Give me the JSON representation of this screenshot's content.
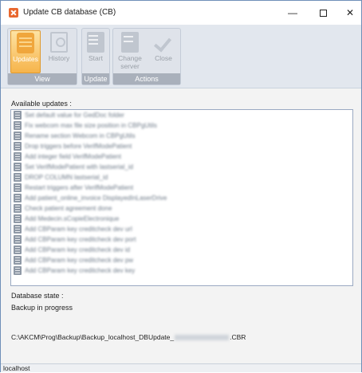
{
  "window": {
    "title": "Update CB database (CB)",
    "minimize_glyph": "—",
    "close_glyph": "✕"
  },
  "ribbon": {
    "groups": [
      {
        "label": "View",
        "buttons": [
          {
            "label": "Updates",
            "icon": "database-icon",
            "active": true
          },
          {
            "label": "History",
            "icon": "history-icon",
            "active": false
          }
        ]
      },
      {
        "label": "Update",
        "buttons": [
          {
            "label": "Start",
            "icon": "start-icon",
            "active": false
          }
        ]
      },
      {
        "label": "Actions",
        "buttons": [
          {
            "label": "Change server",
            "line1": "Change",
            "line2": "server",
            "icon": "server-icon",
            "active": false
          },
          {
            "label": "Close",
            "icon": "check-icon",
            "active": false
          }
        ]
      }
    ]
  },
  "available_updates": {
    "label": "Available updates :",
    "items": [
      "Set default value for GedDoc folder",
      "Fix webcom max file size position in CBPgUtils",
      "Rename section Webcom in CBPgUtils",
      "Drop triggers before VerifModePatient",
      "Add integer field VerifModePatient",
      "Set VerifModePatient with lastserial_id",
      "DROP COLUMN lastserial_id",
      "Restart triggers after VerifModePatient",
      "Add patient_online_invoice DisplayedInLaserDrive",
      "Check patient agreement done",
      "Add Medecin.sCopieElectronique",
      "Add CBParam key creditcheck dev url",
      "Add CBParam key creditcheck dev port",
      "Add CBParam key creditcheck dev id",
      "Add CBParam key creditcheck dev pw",
      "Add CBParam key creditcheck dev key"
    ]
  },
  "database_state": {
    "label": "Database state :",
    "value": "Backup in progress",
    "path_prefix": "C:\\AKCM\\Prog\\Backup\\Backup_localhost_DBUpdate_",
    "path_suffix": ".CBR"
  },
  "statusbar": {
    "server": "localhost"
  },
  "colors": {
    "accent_active": "#f6b44b",
    "group_label_bg": "#a9b0bb",
    "window_border": "#6f8fb8"
  }
}
